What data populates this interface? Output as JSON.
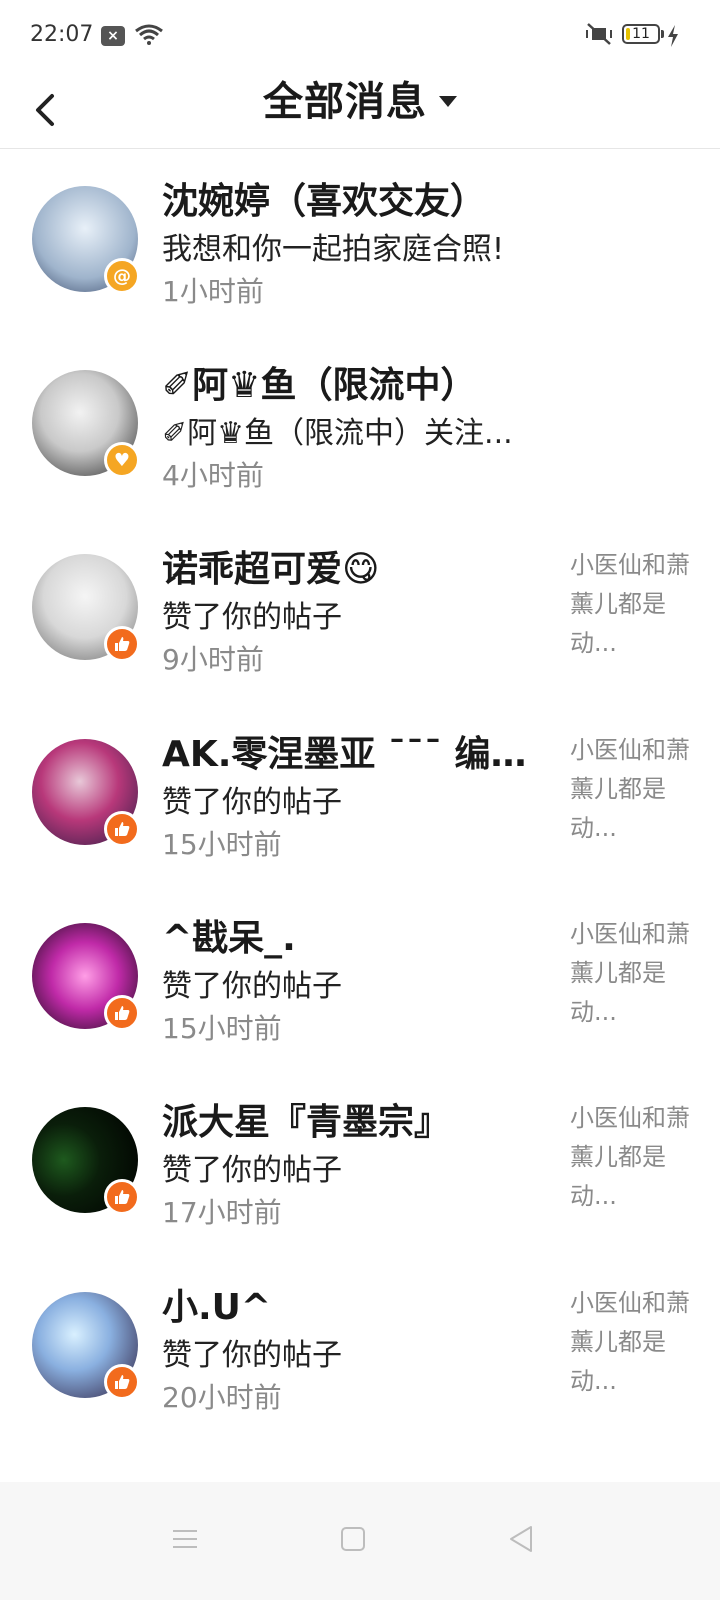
{
  "status_bar": {
    "time": "22:07",
    "battery_level": "11",
    "icons": [
      "app-close-icon",
      "wifi-icon",
      "mute-icon",
      "battery-icon",
      "charge-icon"
    ]
  },
  "header": {
    "title": "全部消息",
    "back_icon": "chevron-left-icon",
    "dropdown_icon": "caret-down-icon"
  },
  "messages": [
    {
      "name": "沈婉婷（喜欢交友）",
      "message": "我想和你一起拍家庭合照!",
      "time": "1小时前",
      "badge": "at-icon",
      "badge_color": "#f5a623",
      "preview": ""
    },
    {
      "name": "✐阿♛鱼（限流中）",
      "message": "✐阿♛鱼（限流中）关注...",
      "time": "4小时前",
      "badge": "heart-icon",
      "badge_color": "#f5a623",
      "preview": ""
    },
    {
      "name": "诺乖超可爱😋",
      "message": "赞了你的帖子",
      "time": "9小时前",
      "badge": "thumbs-up-icon",
      "badge_color": "#f26b1d",
      "preview": "小医仙和萧薰儿都是动..."
    },
    {
      "name": "AK.零涅墨亚 ˉˉˉ 编辑组...",
      "message": "赞了你的帖子",
      "time": "15小时前",
      "badge": "thumbs-up-icon",
      "badge_color": "#f26b1d",
      "preview": "小医仙和萧薰儿都是动..."
    },
    {
      "name": "^戡呆_.",
      "message": "赞了你的帖子",
      "time": "15小时前",
      "badge": "thumbs-up-icon",
      "badge_color": "#f26b1d",
      "preview": "小医仙和萧薰儿都是动..."
    },
    {
      "name": "派大星『青墨宗』",
      "message": "赞了你的帖子",
      "time": "17小时前",
      "badge": "thumbs-up-icon",
      "badge_color": "#f26b1d",
      "preview": "小医仙和萧薰儿都是动..."
    },
    {
      "name": "小.U^",
      "message": "赞了你的帖子",
      "time": "20小时前",
      "badge": "thumbs-up-icon",
      "badge_color": "#f26b1d",
      "preview": "小医仙和萧薰儿都是动..."
    }
  ],
  "nav_bar": {
    "icons": [
      "menu-icon",
      "home-square-icon",
      "back-triangle-icon"
    ]
  }
}
